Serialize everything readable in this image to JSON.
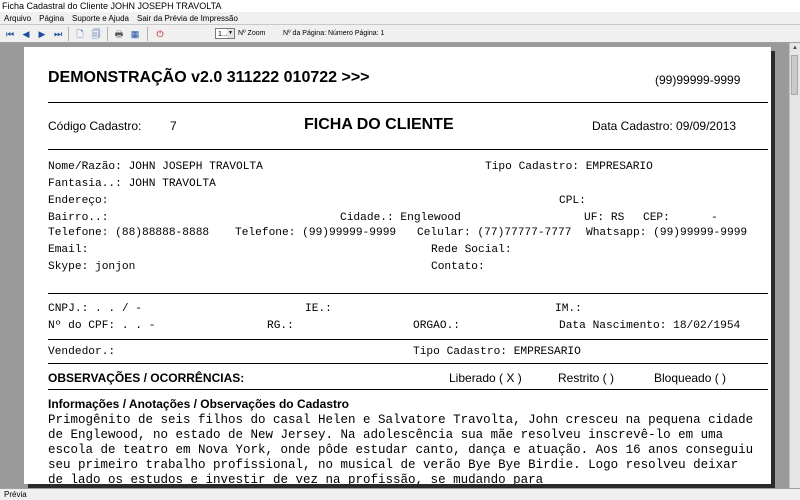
{
  "window": {
    "title": "Ficha Cadastral do Cliente JOHN JOSEPH TRAVOLTA"
  },
  "menu": {
    "items": [
      "Arquivo",
      "Página",
      "Suporte e Ajuda",
      "Sair da Prévia de Impressão"
    ]
  },
  "toolbar": {
    "first_icon": "⏮",
    "prev_icon": "◀",
    "next_icon": "▶",
    "last_icon": "⏭",
    "page_icon": "🗋",
    "pages_icon": "🗐",
    "print_icon": "🖶",
    "export_icon": "▦",
    "close_icon": "⏻",
    "zoom_value": "1...",
    "zoom_arrow": "▼",
    "zoom_label": "Nº Zoom",
    "page_info": "Nº da Página: Número Página: 1"
  },
  "report": {
    "header_title": "DEMONSTRAÇÃO v2.0 311222 010722 >>>",
    "header_phone": "(99)99999-9999",
    "codigo_label": "Código Cadastro:",
    "codigo_value": "7",
    "ficha_title": "FICHA DO CLIENTE",
    "data_cadastro": "Data Cadastro: 09/09/2013",
    "rows": {
      "nome": "Nome/Razão: JOHN JOSEPH TRAVOLTA",
      "tipo": "Tipo Cadastro: EMPRESARIO",
      "fantasia": "Fantasia..: JOHN TRAVOLTA",
      "endereco": "Endereço:",
      "cpl": "CPL:",
      "bairro": "Bairro..:",
      "cidade": "Cidade.: Englewood",
      "uf": "UF: RS",
      "cep": "CEP:",
      "cep_val": "-",
      "tel1": "Telefone: (88)88888-8888",
      "tel2": "Telefone: (99)99999-9999",
      "celular": "Celular: (77)77777-7777",
      "whatsapp": "Whatsapp: (99)99999-9999",
      "email": "Email:",
      "rede": "Rede Social:",
      "skype": "Skype: jonjon",
      "contato": "Contato:",
      "cnpj": "CNPJ.:   .   .   /   -",
      "ie": "IE.:",
      "im": "IM.:",
      "cpf": "Nº do CPF:    .   .   -",
      "rg": "RG.:",
      "orgao": "ORGAO.:",
      "nasc": "Data Nascimento: 18/02/1954",
      "vendedor": "Vendedor.:",
      "tipo2": "Tipo Cadastro: EMPRESARIO"
    },
    "obs_title": "OBSERVAÇÕES / OCORRÊNCIAS:",
    "liberado": "Liberado ( X )",
    "restrito": "Restrito (   )",
    "bloqueado": "Bloqueado (   )",
    "info_title": "Informações / Anotações / Observações do Cadastro",
    "info_text": "Primogênito de seis filhos do casal Helen e Salvatore Travolta, John cresceu na pequena cidade de Englewood, no estado de New Jersey. Na adolescência sua mãe resolveu inscrevê-lo em uma escola de teatro em Nova York, onde pôde estudar canto, dança e atuação. Aos 16 anos conseguiu seu primeiro trabalho profissional, no musical de verão Bye Bye Birdie. Logo resolveu deixar de lado os estudos e investir de vez na profissão, se mudando para"
  },
  "status": {
    "text": "Prévia"
  }
}
